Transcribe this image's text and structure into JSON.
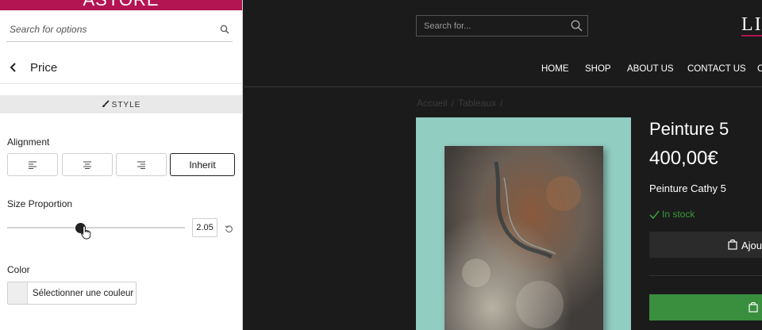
{
  "panel": {
    "brand": "ASTORE",
    "search_placeholder": "Search for options",
    "section_title": "Price",
    "tab_label": "STYLE",
    "alignment_label": "Alignment",
    "alignment_inherit": "Inherit",
    "size_label": "Size Proportion",
    "size_value": "2.05",
    "size_fraction": 0.42,
    "color_label": "Color",
    "color_button": "Sélectionner une couleur"
  },
  "shop": {
    "search_placeholder": "Search for...",
    "logo": "LIN",
    "nav": [
      "HOME",
      "SHOP",
      "ABOUT US",
      "CONTACT US",
      "C"
    ],
    "breadcrumb": [
      "Accueil",
      "Tableaux"
    ],
    "product_title": "Peinture 5",
    "product_price": "400,00€",
    "product_desc": "Peinture Cathy 5",
    "stock": "In stock",
    "add_button": "Ajou"
  },
  "colors": {
    "brand": "#b31452",
    "image_bg": "#92cdc1",
    "stock_green": "#3a9a3a",
    "buy_green": "#3a8f3e"
  }
}
